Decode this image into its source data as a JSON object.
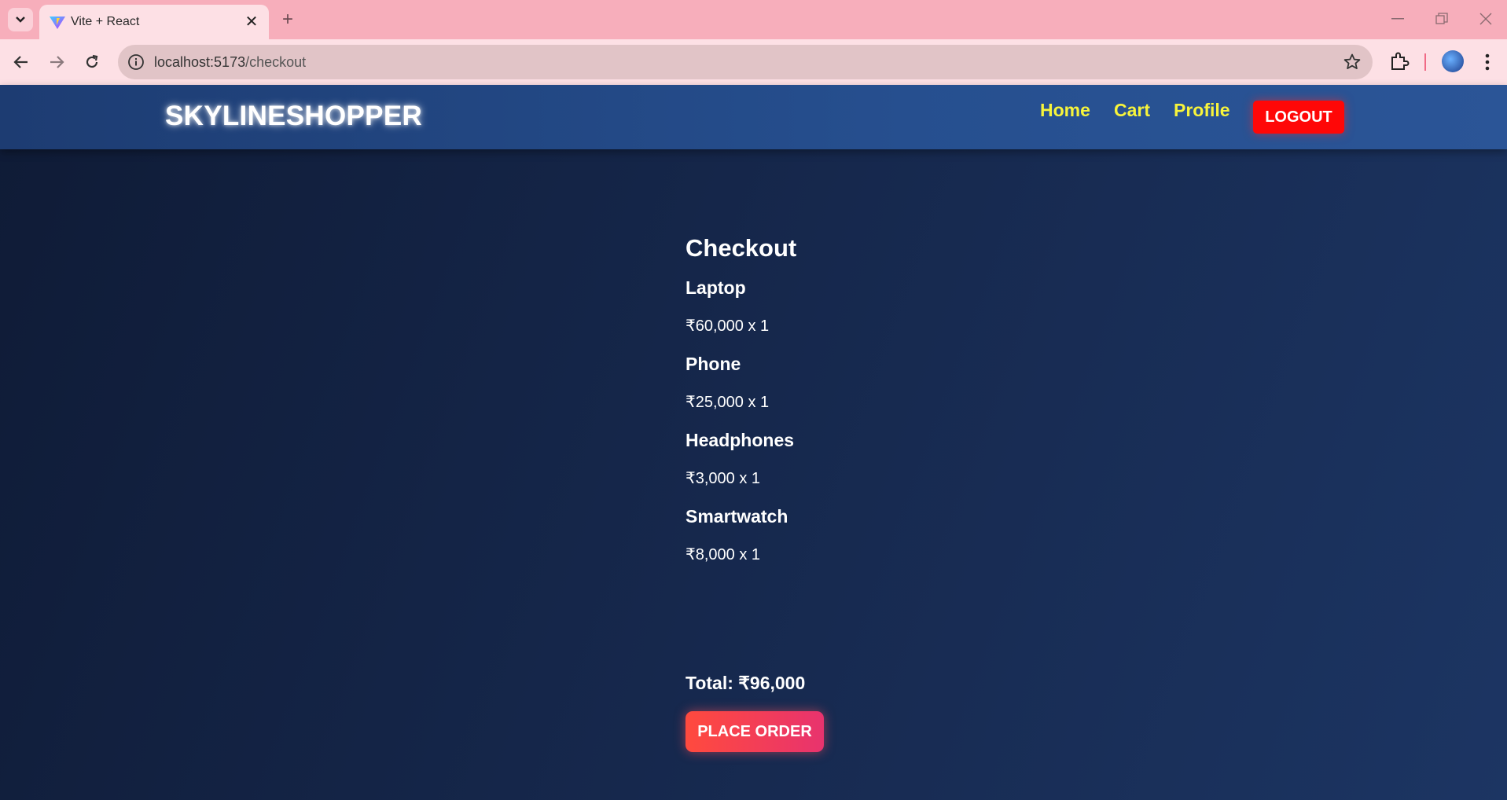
{
  "browser": {
    "tab_title": "Vite + React",
    "url_host": "localhost:5173",
    "url_path": "/checkout"
  },
  "navbar": {
    "brand": "SKYLINESHOPPER",
    "links": [
      "Home",
      "Cart",
      "Profile"
    ],
    "logout_label": "LOGOUT",
    "link_color": "#f7f43b",
    "logout_color": "#ff0707"
  },
  "checkout": {
    "title": "Checkout",
    "items": [
      {
        "name": "Laptop",
        "price_line": "₹60,000 x 1"
      },
      {
        "name": "Phone",
        "price_line": "₹25,000 x 1"
      },
      {
        "name": "Headphones",
        "price_line": "₹3,000 x 1"
      },
      {
        "name": "Smartwatch",
        "price_line": "₹8,000 x 1"
      }
    ],
    "total": "Total: ₹96,000",
    "place_order_label": "PLACE ORDER"
  }
}
